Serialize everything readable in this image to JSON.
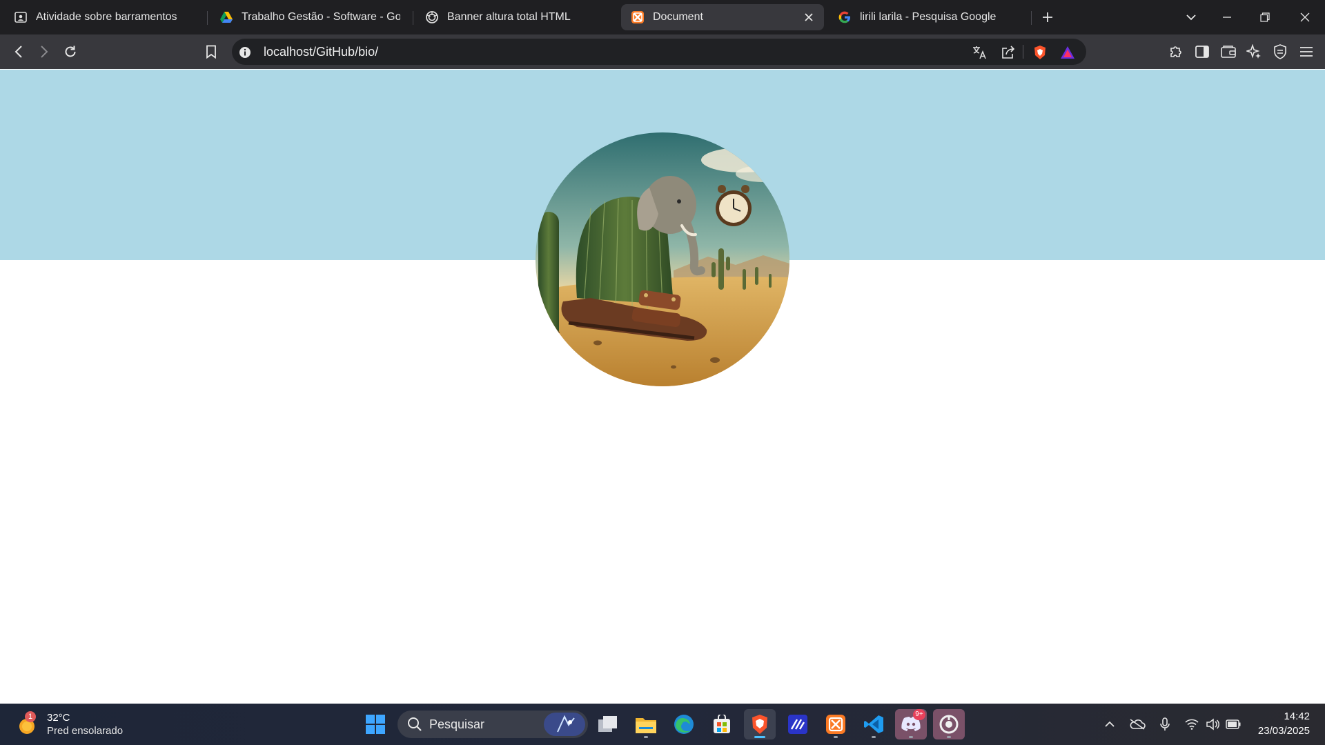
{
  "browser": {
    "tabs": [
      {
        "title": "Atividade sobre barramentos",
        "icon": "classroom-icon"
      },
      {
        "title": "Trabalho Gestão - Software - Googl",
        "icon": "google-drive-icon"
      },
      {
        "title": "Banner altura total HTML",
        "icon": "chatgpt-icon"
      },
      {
        "title": "Document",
        "icon": "xampp-icon",
        "active": true
      },
      {
        "title": "lirili larila - Pesquisa Google",
        "icon": "google-icon"
      }
    ],
    "address": {
      "url": "localhost/GitHub/bio/"
    }
  },
  "page": {
    "banner_color": "#add8e6",
    "avatar": {
      "description_icon": "profile-image"
    }
  },
  "taskbar": {
    "weather": {
      "badge": "1",
      "temp": "32°C",
      "condition": "Pred ensolarado"
    },
    "search_placeholder": "Pesquisar",
    "discord_badge": "9+",
    "clock": {
      "time": "14:42",
      "date": "23/03/2025"
    }
  }
}
